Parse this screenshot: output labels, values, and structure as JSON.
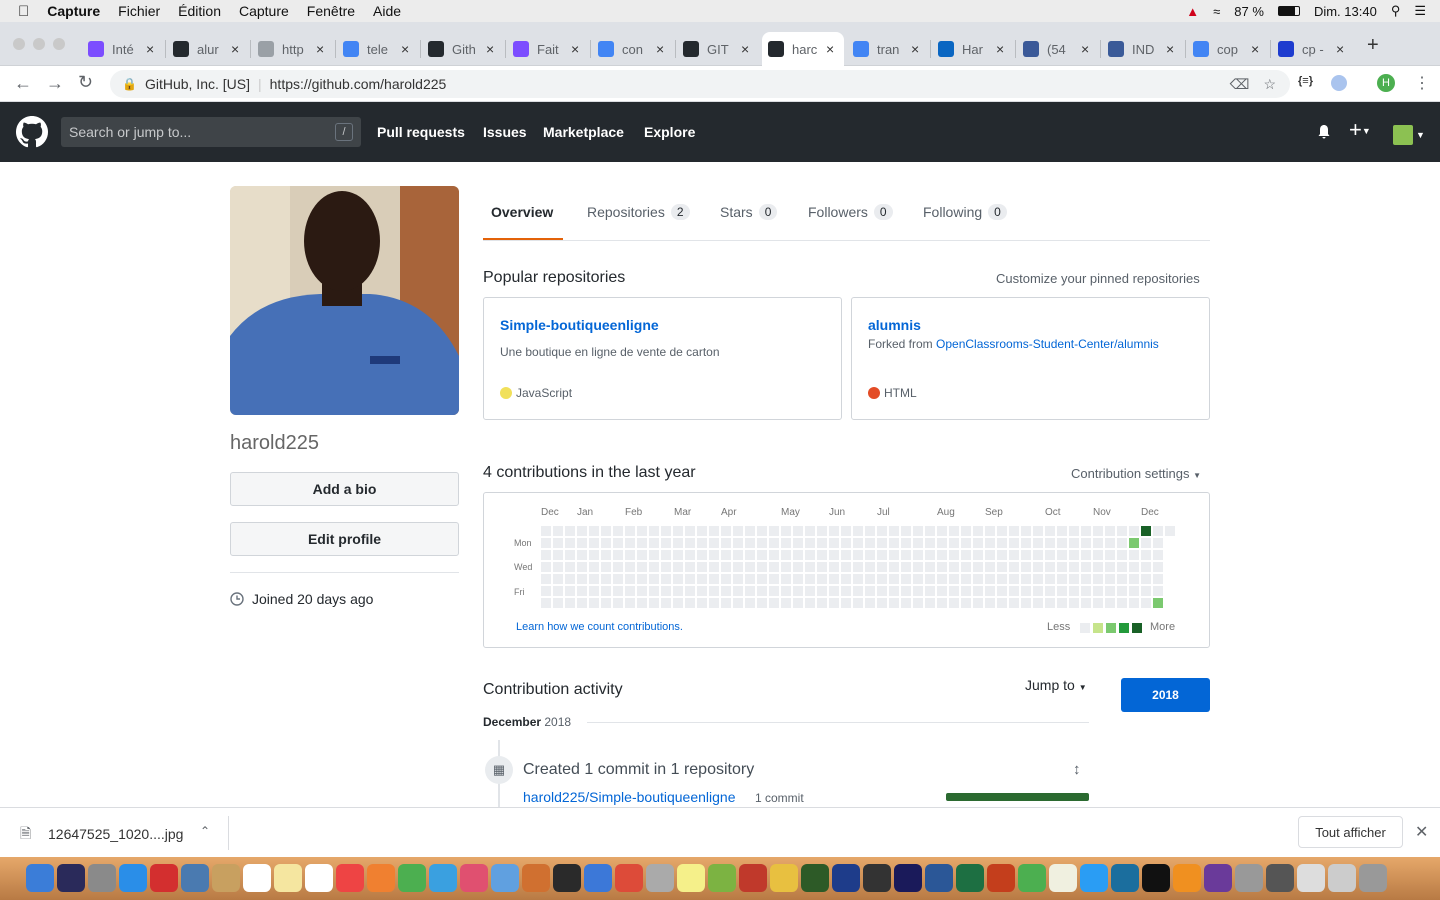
{
  "menubar": {
    "app": "Capture",
    "items": [
      "Fichier",
      "Édition",
      "Capture",
      "Fenêtre",
      "Aide"
    ],
    "battery": "87 %",
    "clock": "Dim. 13:40"
  },
  "tabs": [
    {
      "title": "Inté",
      "icon": "dash-icon",
      "color": "#7c4dff"
    },
    {
      "title": "alur",
      "icon": "github-icon",
      "color": "#24292e"
    },
    {
      "title": "http",
      "icon": "page-icon",
      "color": "#9aa0a6"
    },
    {
      "title": "tele",
      "icon": "google-icon",
      "color": "#4285f4"
    },
    {
      "title": "Gith",
      "icon": "github-icon",
      "color": "#24292e"
    },
    {
      "title": "Fait",
      "icon": "dash-icon",
      "color": "#7c4dff"
    },
    {
      "title": "con",
      "icon": "google-icon",
      "color": "#4285f4"
    },
    {
      "title": "GIT",
      "icon": "github-icon",
      "color": "#24292e"
    },
    {
      "title": "harc",
      "icon": "github-icon",
      "color": "#24292e",
      "active": true
    },
    {
      "title": "tran",
      "icon": "google-icon",
      "color": "#4285f4"
    },
    {
      "title": "Har",
      "icon": "linkedin-icon",
      "color": "#0a66c2"
    },
    {
      "title": "(54",
      "icon": "facebook-icon",
      "color": "#3b5998"
    },
    {
      "title": "IND",
      "icon": "ind-icon",
      "color": "#3a5a98"
    },
    {
      "title": "cop",
      "icon": "google-icon",
      "color": "#4285f4"
    },
    {
      "title": "cp -",
      "icon": "io-icon",
      "color": "#1e3ccf"
    }
  ],
  "address": {
    "secure_label": "GitHub, Inc. [US]",
    "url": "https://github.com/harold225"
  },
  "github": {
    "search_placeholder": "Search or jump to...",
    "slash": "/",
    "nav": [
      "Pull requests",
      "Issues",
      "Marketplace",
      "Explore"
    ]
  },
  "profile": {
    "username": "harold225",
    "add_bio": "Add a bio",
    "edit_profile": "Edit profile",
    "joined": "Joined 20 days ago"
  },
  "profile_tabs": [
    {
      "label": "Overview",
      "count": null
    },
    {
      "label": "Repositories",
      "count": "2"
    },
    {
      "label": "Stars",
      "count": "0"
    },
    {
      "label": "Followers",
      "count": "0"
    },
    {
      "label": "Following",
      "count": "0"
    }
  ],
  "popular": {
    "title": "Popular repositories",
    "customize": "Customize your pinned repositories",
    "repos": [
      {
        "name": "Simple-boutiqueenligne",
        "desc": "Une boutique en ligne de vente de carton",
        "language": "JavaScript",
        "lang_color": "#f1e05a"
      },
      {
        "name": "alumnis",
        "forked_prefix": "Forked from ",
        "forked_from": "OpenClassrooms-Student-Center/alumnis",
        "language": "HTML",
        "lang_color": "#e34c26"
      }
    ]
  },
  "contributions": {
    "title": "4 contributions in the last year",
    "settings": "Contribution settings",
    "months": [
      "Dec",
      "Jan",
      "Feb",
      "Mar",
      "Apr",
      "May",
      "Jun",
      "Jul",
      "Aug",
      "Sep",
      "Oct",
      "Nov",
      "Dec"
    ],
    "days": [
      "Mon",
      "Wed",
      "Fri"
    ],
    "learn": "Learn how we count contributions.",
    "less": "Less",
    "more": "More",
    "levels": [
      "#ebedf0",
      "#c6e48b",
      "#7bc96f",
      "#239a3b",
      "#196127"
    ]
  },
  "activity": {
    "title": "Contribution activity",
    "jump": "Jump to",
    "year": "2018",
    "month": "December",
    "month_year": "2018",
    "created": "Created 1 commit in 1 repository",
    "repo": "harold225/Simple-boutiqueenligne",
    "commits": "1 commit"
  },
  "download": {
    "file": "12647525_1020....jpg",
    "show_all": "Tout afficher"
  }
}
